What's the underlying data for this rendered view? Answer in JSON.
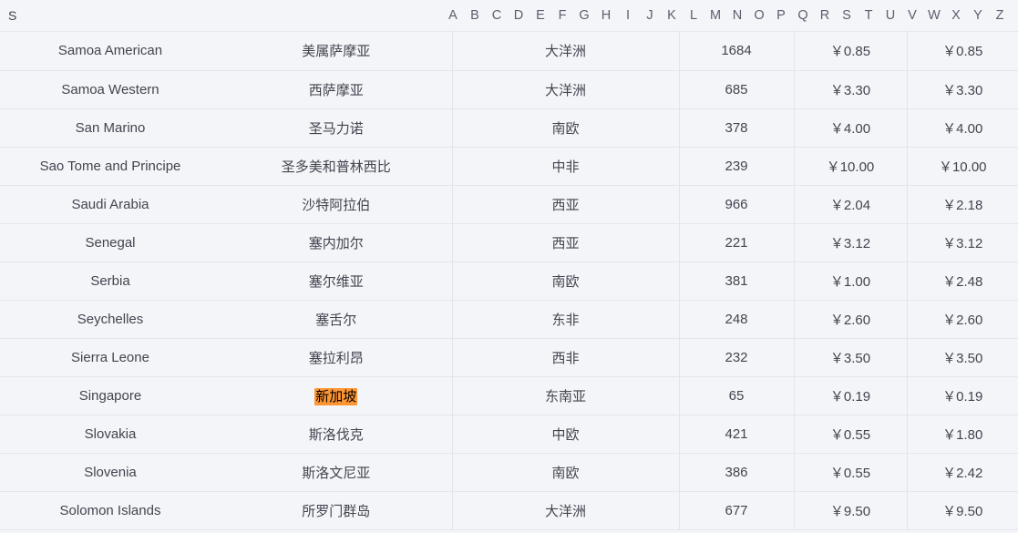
{
  "index_bar": {
    "current_letter": "S",
    "alphabet": [
      "A",
      "B",
      "C",
      "D",
      "E",
      "F",
      "G",
      "H",
      "I",
      "J",
      "K",
      "L",
      "M",
      "N",
      "O",
      "P",
      "Q",
      "R",
      "S",
      "T",
      "U",
      "V",
      "W",
      "X",
      "Y",
      "Z"
    ]
  },
  "highlight": {
    "text": "新加坡",
    "color": "#ff9632"
  },
  "table": {
    "rows": [
      {
        "en": "Samoa American",
        "cn": "美属萨摩亚",
        "region": "大洋洲",
        "code": "1684",
        "price1": "￥0.85",
        "price2": "￥0.85",
        "highlight": false
      },
      {
        "en": "Samoa Western",
        "cn": "西萨摩亚",
        "region": "大洋洲",
        "code": "685",
        "price1": "￥3.30",
        "price2": "￥3.30",
        "highlight": false
      },
      {
        "en": "San Marino",
        "cn": "圣马力诺",
        "region": "南欧",
        "code": "378",
        "price1": "￥4.00",
        "price2": "￥4.00",
        "highlight": false
      },
      {
        "en": "Sao Tome and Principe",
        "cn": "圣多美和普林西比",
        "region": "中非",
        "code": "239",
        "price1": "￥10.00",
        "price2": "￥10.00",
        "highlight": false
      },
      {
        "en": "Saudi Arabia",
        "cn": "沙特阿拉伯",
        "region": "西亚",
        "code": "966",
        "price1": "￥2.04",
        "price2": "￥2.18",
        "highlight": false
      },
      {
        "en": "Senegal",
        "cn": "塞内加尔",
        "region": "西亚",
        "code": "221",
        "price1": "￥3.12",
        "price2": "￥3.12",
        "highlight": false
      },
      {
        "en": "Serbia",
        "cn": "塞尔维亚",
        "region": "南欧",
        "code": "381",
        "price1": "￥1.00",
        "price2": "￥2.48",
        "highlight": false
      },
      {
        "en": "Seychelles",
        "cn": "塞舌尔",
        "region": "东非",
        "code": "248",
        "price1": "￥2.60",
        "price2": "￥2.60",
        "highlight": false
      },
      {
        "en": "Sierra Leone",
        "cn": "塞拉利昂",
        "region": "西非",
        "code": "232",
        "price1": "￥3.50",
        "price2": "￥3.50",
        "highlight": false
      },
      {
        "en": "Singapore",
        "cn": "新加坡",
        "region": "东南亚",
        "code": "65",
        "price1": "￥0.19",
        "price2": "￥0.19",
        "highlight": true
      },
      {
        "en": "Slovakia",
        "cn": "斯洛伐克",
        "region": "中欧",
        "code": "421",
        "price1": "￥0.55",
        "price2": "￥1.80",
        "highlight": false
      },
      {
        "en": "Slovenia",
        "cn": "斯洛文尼亚",
        "region": "南欧",
        "code": "386",
        "price1": "￥0.55",
        "price2": "￥2.42",
        "highlight": false
      },
      {
        "en": "Solomon Islands",
        "cn": "所罗门群岛",
        "region": "大洋洲",
        "code": "677",
        "price1": "￥9.50",
        "price2": "￥9.50",
        "highlight": false
      }
    ]
  }
}
